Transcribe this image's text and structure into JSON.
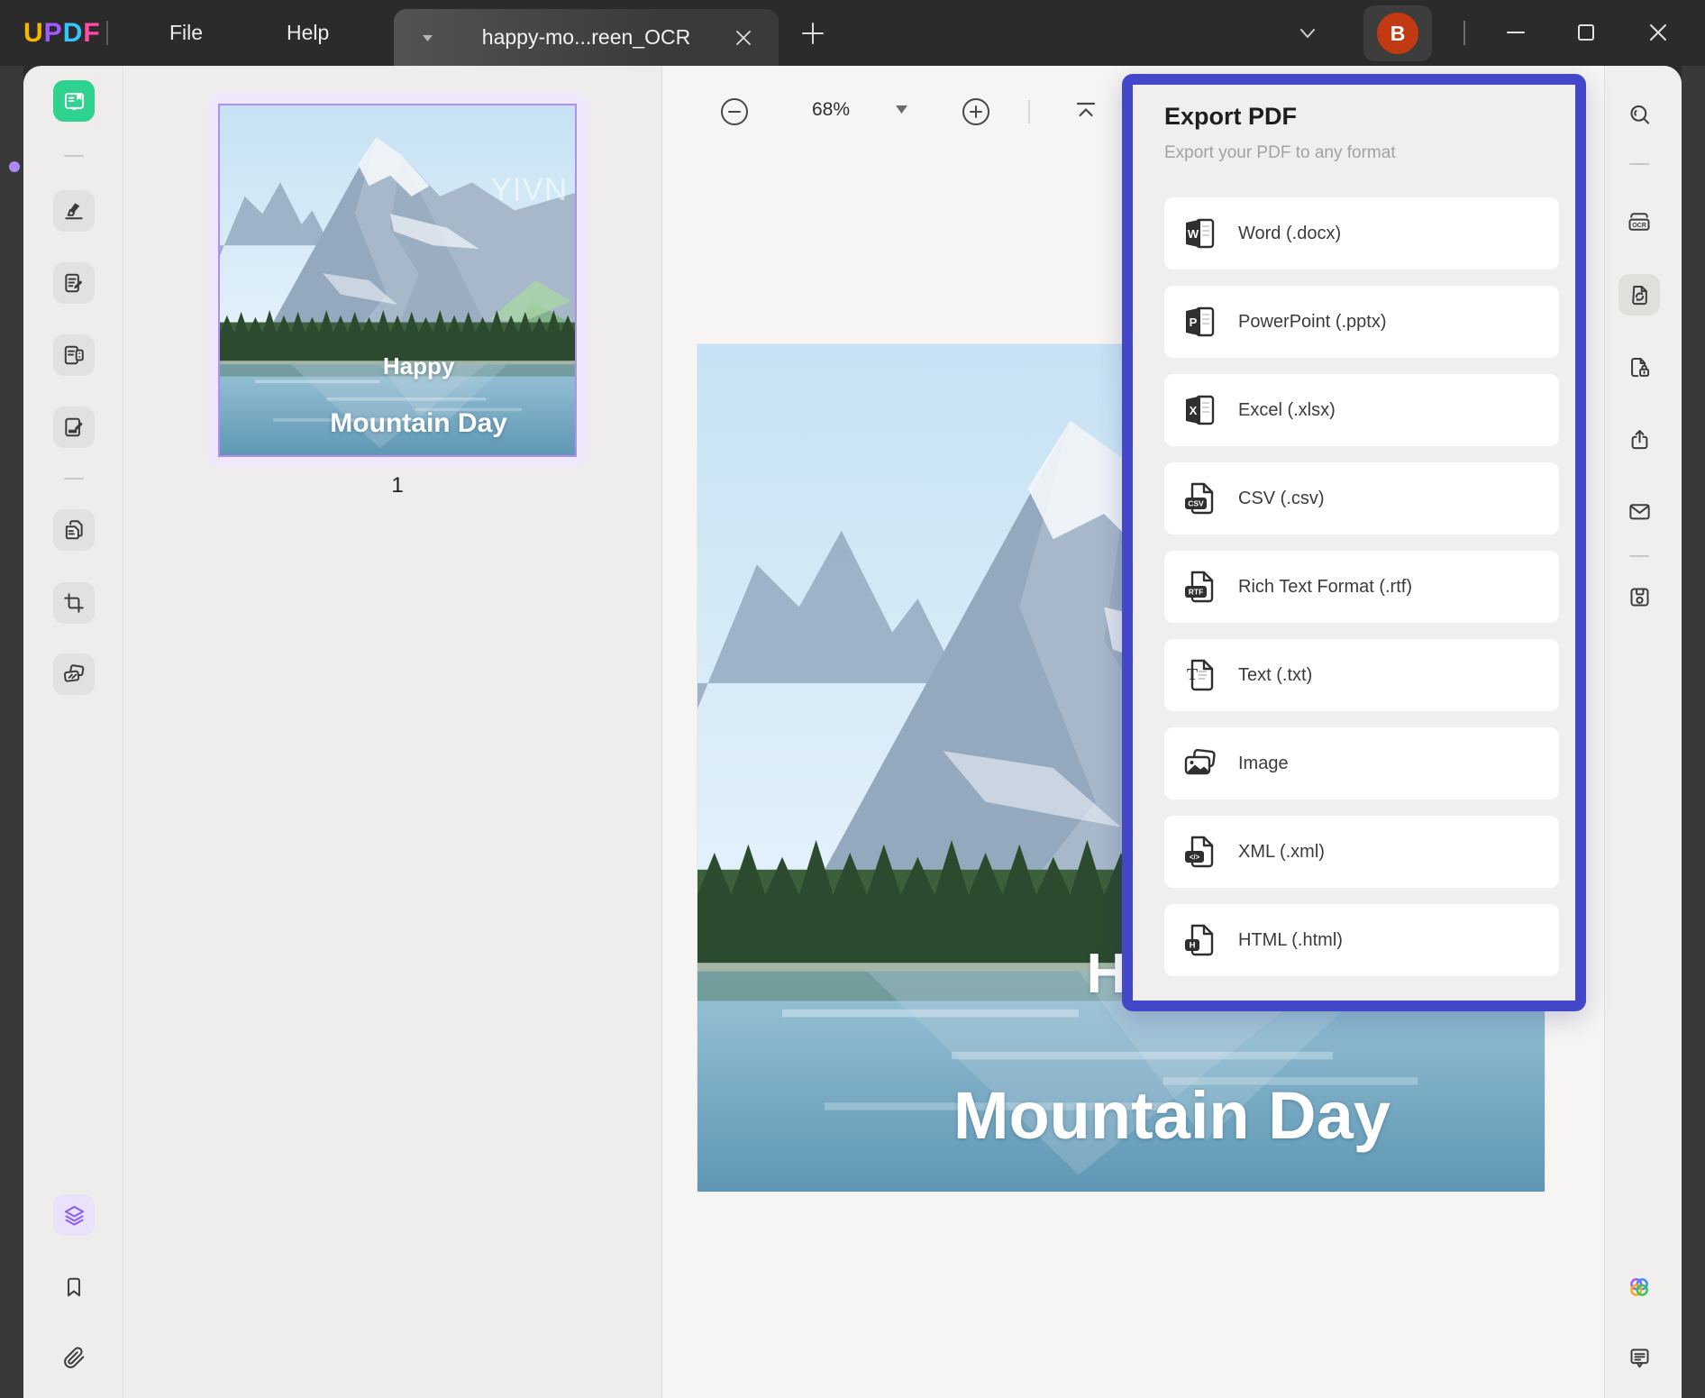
{
  "titlebar": {
    "logo_letters": [
      {
        "char": "U",
        "color": "#f7b500"
      },
      {
        "char": "P",
        "color": "#a259ff"
      },
      {
        "char": "D",
        "color": "#32c5ff"
      },
      {
        "char": "F",
        "color": "#ff4ca6"
      }
    ],
    "menus": [
      {
        "label": "File"
      },
      {
        "label": "Help"
      }
    ],
    "tab": {
      "title": "happy-mo...reen_OCR"
    },
    "account_initial": "B"
  },
  "toolbar": {
    "zoom_level": "68%"
  },
  "thumbnail_panel": {
    "page_number": "1"
  },
  "document": {
    "watermark": "YIVN",
    "caption_line1": "Happy",
    "caption_line2": "Mountain Day"
  },
  "right_rail": {
    "ocr_label": "OCR"
  },
  "export_panel": {
    "title": "Export PDF",
    "subtitle": "Export your PDF to any format",
    "items": [
      {
        "id": "word",
        "label": "Word (.docx)",
        "badge": "W"
      },
      {
        "id": "powerpoint",
        "label": "PowerPoint (.pptx)",
        "badge": "P"
      },
      {
        "id": "excel",
        "label": "Excel (.xlsx)",
        "badge": "X"
      },
      {
        "id": "csv",
        "label": "CSV (.csv)",
        "badge": "CSV"
      },
      {
        "id": "rtf",
        "label": "Rich Text Format (.rtf)",
        "badge": "RTF"
      },
      {
        "id": "text",
        "label": "Text (.txt)",
        "badge": "T"
      },
      {
        "id": "image",
        "label": "Image",
        "badge": ""
      },
      {
        "id": "xml",
        "label": "XML (.xml)",
        "badge": "</>"
      },
      {
        "id": "html",
        "label": "HTML (.html)",
        "badge": "H"
      }
    ]
  },
  "colors": {
    "accent_blue": "#4348c9",
    "active_green": "#2fd28f",
    "accent_purple": "#8b5cf6",
    "avatar_red": "#c23a12"
  }
}
